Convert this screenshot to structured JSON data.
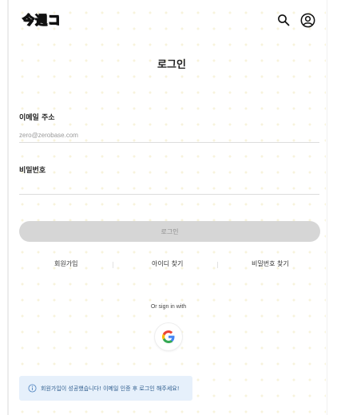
{
  "header": {
    "logo_text": "今週コ",
    "search_icon": "search-icon",
    "account_icon": "user-circle-icon"
  },
  "page": {
    "title": "로그인"
  },
  "form": {
    "email_label": "이메일 주소",
    "email_placeholder": "zero@zerobase.com",
    "email_value": "",
    "password_label": "비밀번호",
    "password_placeholder": "",
    "password_value": "",
    "login_button_label": "로그인"
  },
  "links": {
    "signup": "회원가입",
    "find_id": "아이디 찾기",
    "find_password": "비밀번호 찾기"
  },
  "social": {
    "or_text": "Or sign in with",
    "google_icon": "google-icon"
  },
  "toast": {
    "icon": "info-icon",
    "message": "회원가입이 성공했습니다! 이메일 인증 후 로그인 해주세요!"
  },
  "colors": {
    "login_button_bg": "#d6d6d6",
    "toast_bg": "#e6f0fb",
    "toast_text": "#2e5d8e"
  }
}
